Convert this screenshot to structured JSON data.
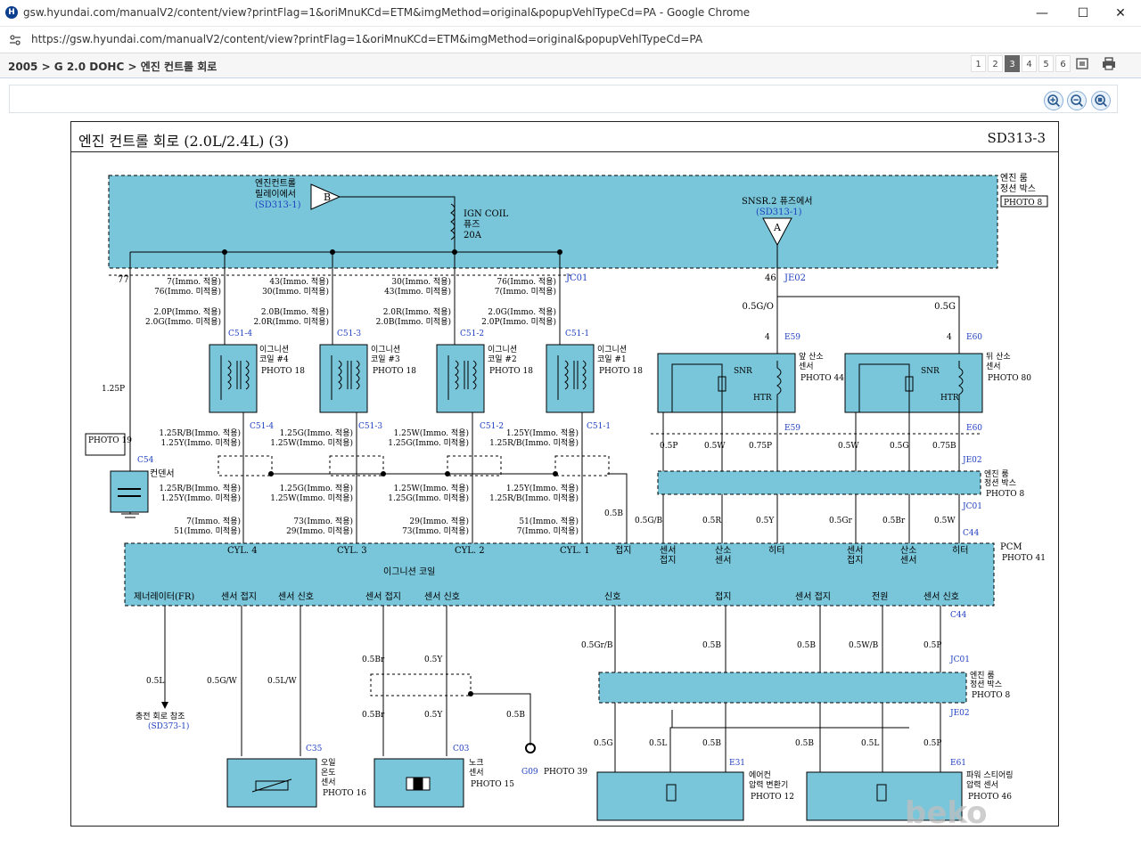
{
  "window": {
    "title": "gsw.hyundai.com/manualV2/content/view?printFlag=1&oriMnuKCd=ETM&imgMethod=original&popupVehlTypeCd=PA - Google Chrome",
    "url": "https://gsw.hyundai.com/manualV2/content/view?printFlag=1&oriMnuKCd=ETM&imgMethod=original&popupVehlTypeCd=PA"
  },
  "breadcrumb": "2005 > G 2.0 DOHC > 엔진 컨트롤 회로",
  "pager": {
    "pages": [
      "1",
      "2",
      "3",
      "4",
      "5",
      "6"
    ],
    "active": "3"
  },
  "diagram": {
    "title": "엔진 컨트롤 회로 (2.0L/2.4L) (3)",
    "code": "SD313-3",
    "colors": {
      "component": "#79c6da",
      "line": "#000000",
      "link": "#2040c0"
    },
    "labels": {
      "ecr_from": "엔진컨트롤",
      "ecr_from2": "릴레이에서",
      "ecr_ref": "(SD313-1)",
      "conn_b": "B",
      "ign_fuse1": "IGN COIL",
      "ign_fuse2": "퓨즈",
      "ign_fuse3": "20A",
      "snsr_from": "SNSR.2 퓨즈에서",
      "snsr_ref": "(SD313-1)",
      "conn_a": "A",
      "ejb1": "엔진 룸",
      "ejb2": "정션 박스",
      "photo8": "PHOTO 8",
      "pin77": "77",
      "pin46": "46",
      "jc01": "JC01",
      "je02": "JE02",
      "w_2_7": "7(Immo. 적용)",
      "w_2_76": "76(Immo. 미적용)",
      "w_3_43": "43(Immo. 적용)",
      "w_3_30": "30(Immo. 미적용)",
      "w_4_30": "30(Immo. 적용)",
      "w_4_43": "43(Immo. 미적용)",
      "w_5_76": "76(Immo. 적용)",
      "w_5_7": "7(Immo. 미적용)",
      "c1a": "2.0P(Immo. 적용)",
      "c1b": "2.0G(Immo. 미적용)",
      "c2a": "2.0B(Immo. 적용)",
      "c2b": "2.0R(Immo. 미적용)",
      "c3a": "2.0R(Immo. 적용)",
      "c3b": "2.0B(Immo. 미적용)",
      "c4a": "2.0G(Immo. 적용)",
      "c4b": "2.0P(Immo. 미적용)",
      "g05o": "0.5G/O",
      "g05g": "0.5G",
      "pin4": "4",
      "e59": "E59",
      "e60": "E60",
      "c514": "C51-4",
      "c513": "C51-3",
      "c512": "C51-2",
      "c511": "C51-1",
      "coil4a": "이그니션",
      "coil4b": "코일 #4",
      "coil3b": "코일 #3",
      "coil2b": "코일 #2",
      "coil1b": "코일 #1",
      "photo18": "PHOTO 18",
      "fo2a": "앞 산소",
      "fo2b": "센서",
      "ro2a": "뒤 산소",
      "snr": "SNR",
      "htr": "HTR",
      "photo44": "PHOTO 44",
      "photo80": "PHOTO 80",
      "p125p": "1.25P",
      "photo19": "PHOTO 19",
      "c54": "C54",
      "cond": "컨덴서",
      "b1a": "1.25R/B(Immo. 적용)",
      "b1b": "1.25Y(Immo. 미적용)",
      "b2a": "1.25G(Immo. 적용)",
      "b2b": "1.25W(Immo. 미적용)",
      "b3a": "1.25W(Immo. 적용)",
      "b3b": "1.25G(Immo. 미적용)",
      "b4a": "1.25Y(Immo. 적용)",
      "b4b": "1.25R/B(Immo. 미적용)",
      "e1a": "7(Immo. 적용)",
      "e1b": "51(Immo. 미적용)",
      "e2a": "73(Immo. 적용)",
      "e2b": "29(Immo. 미적용)",
      "e3a": "29(Immo. 적용)",
      "e3b": "73(Immo. 미적용)",
      "e4a": "51(Immo. 적용)",
      "e4b": "7(Immo. 미적용)",
      "w05p": "0.5P",
      "w05w": "0.5W",
      "w075p": "0.75P",
      "w05g": "0.5G",
      "w075b": "0.75B",
      "w05b": "0.5B",
      "w05gb": "0.5G/B",
      "w05r": "0.5R",
      "w05y": "0.5Y",
      "w05gr": "0.5Gr",
      "w05br": "0.5Br",
      "c44": "C44",
      "pcm": "PCM",
      "photo41": "PHOTO 41",
      "cyl4": "CYL. 4",
      "cyl3": "CYL. 3",
      "cyl2": "CYL. 2",
      "cyl1": "CYL. 1",
      "igncoil": "이그니션 코일",
      "ground": "접지",
      "sgnd1": "센서",
      "sgnd2": "접지",
      "o2s1": "산소",
      "o2s2": "센서",
      "heater": "히터",
      "gen": "제너레이터(FR)",
      "sgnd": "센서 접지",
      "ssig": "센서 신호",
      "signal": "신호",
      "power": "전원",
      "w05l": "0.5L",
      "w05gw": "0.5G/W",
      "w05lw": "0.5L/W",
      "w05grb": "0.5Gr/B",
      "w05wb": "0.5W/B",
      "charge1": "충전 회로 참조",
      "charge2": "(SD373-1)",
      "c35": "C35",
      "c03": "C03",
      "g09": "G09",
      "photo39": "PHOTO 39",
      "oil1": "오일",
      "oil2": "온도",
      "oil3": "센서",
      "photo16": "PHOTO 16",
      "knock1": "노크",
      "knock2": "센서",
      "photo15": "PHOTO 15",
      "e31": "E31",
      "e61": "E61",
      "ac1": "에어컨",
      "ac2": "압력 변환기",
      "photo12": "PHOTO 12",
      "ps1": "파워 스티어링",
      "ps2": "압력 센서",
      "photo46": "PHOTO 46"
    }
  },
  "watermark": "beko"
}
